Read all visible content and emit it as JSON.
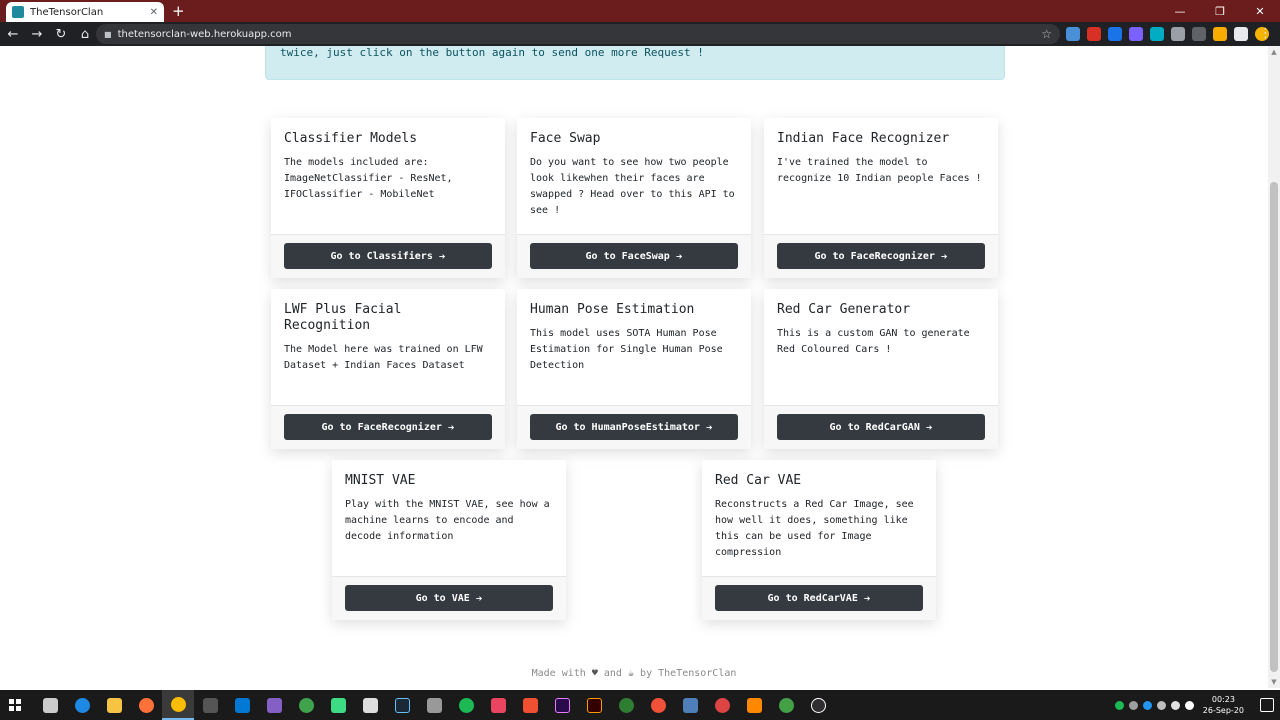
{
  "browser": {
    "tab_title": "TheTensorClan",
    "tab_close": "✕",
    "new_tab": "+",
    "url": "thetensorclan-web.herokuapp.com",
    "window_controls": {
      "minimize": "—",
      "maximize": "❐",
      "close": "✕"
    }
  },
  "alert": {
    "text": "twice, just click on the button again to send one more Request !"
  },
  "cards": [
    {
      "title": "Classifier Models",
      "text": "The models included are: ImageNetClassifier - ResNet, IFOClassifier - MobileNet",
      "button": "Go to Classifiers"
    },
    {
      "title": "Face Swap",
      "text": "Do you want to see how two people look likewhen their faces are swapped ? Head over to this API to see !",
      "button": "Go to FaceSwap"
    },
    {
      "title": "Indian Face Recognizer",
      "text": "I've trained the model to recognize 10 Indian people Faces !",
      "button": "Go to FaceRecognizer"
    },
    {
      "title": "LWF Plus Facial Recognition",
      "text": "The Model here was trained on LFW Dataset + Indian Faces Dataset",
      "button": "Go to FaceRecognizer"
    },
    {
      "title": "Human Pose Estimation",
      "text": "This model uses SOTA Human Pose Estimation for Single Human Pose Detection",
      "button": "Go to HumanPoseEstimator"
    },
    {
      "title": "Red Car Generator",
      "text": "This is a custom GAN to generate Red Coloured Cars !",
      "button": "Go to RedCarGAN"
    },
    {
      "title": "MNIST VAE",
      "text": "Play with the MNIST VAE, see how a machine learns to encode and decode information",
      "button": "Go to VAE"
    },
    {
      "title": "Red Car VAE",
      "text": "Reconstructs a Red Car Image, see how well it does, something like this can be used for Image compression",
      "button": "Go to RedCarVAE"
    }
  ],
  "footer": {
    "made_with": "Made with",
    "and": "and",
    "by": "by TheTensorClan",
    "heart_glyph": "♥",
    "coffee_glyph": "☕"
  },
  "taskbar": {
    "time": "00:23",
    "date": "26-Sep-20"
  },
  "colors": {
    "button_bg": "#343a40",
    "alert_bg": "#d1ecf1",
    "alert_text": "#0c5460",
    "title_bar": "#6b1d1d"
  }
}
